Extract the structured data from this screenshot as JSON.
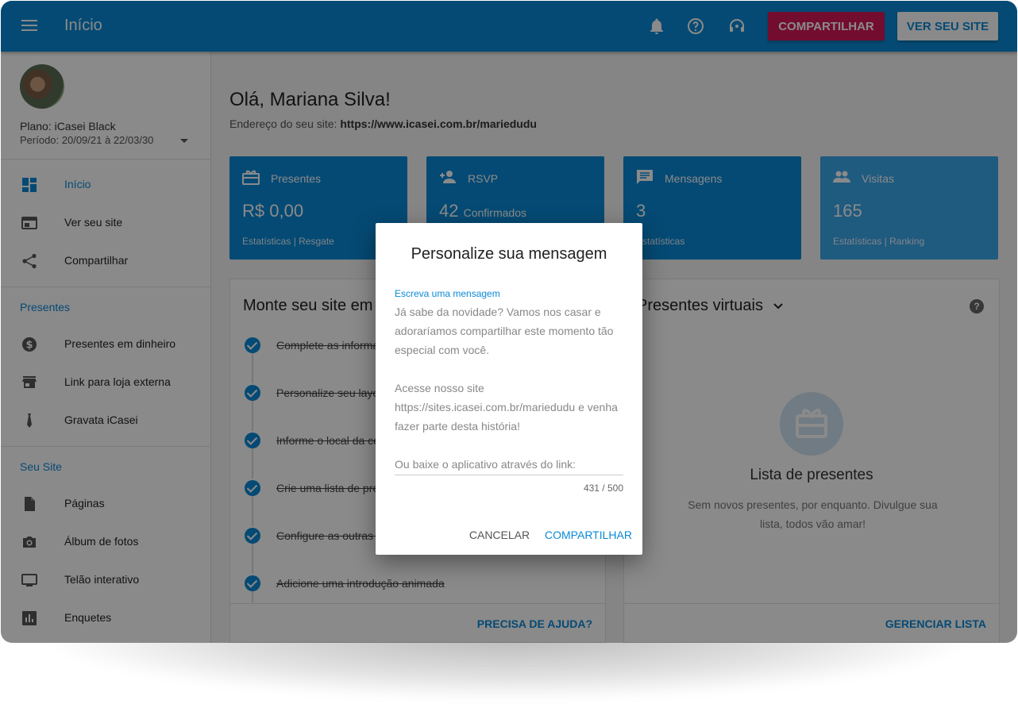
{
  "topbar": {
    "title": "Início",
    "share_label": "COMPARTILHAR",
    "site_label": "VER SEU SITE",
    "icons": [
      "menu-icon",
      "bell-icon",
      "help-circle-icon",
      "support-icon"
    ]
  },
  "sidebar": {
    "plan": "Plano: iCasei Black",
    "period": "Período: 20/09/21 à 22/03/30",
    "items": [
      {
        "label": "Início",
        "icon": "dashboard-icon"
      },
      {
        "label": "Ver seu site",
        "icon": "browser-icon"
      },
      {
        "label": "Compartilhar",
        "icon": "share-icon"
      }
    ],
    "section_gifts": "Presentes",
    "gift_items": [
      {
        "label": "Presentes em dinheiro",
        "icon": "dollar-icon"
      },
      {
        "label": "Link para loja externa",
        "icon": "store-icon"
      },
      {
        "label": "Gravata iCasei",
        "icon": "tie-icon"
      }
    ],
    "section_site": "Seu Site",
    "site_items": [
      {
        "label": "Páginas",
        "icon": "page-icon"
      },
      {
        "label": "Álbum de fotos",
        "icon": "camera-icon"
      },
      {
        "label": "Telão interativo",
        "icon": "monitor-icon"
      },
      {
        "label": "Enquetes",
        "icon": "poll-icon"
      }
    ]
  },
  "main": {
    "greeting": "Olá, Mariana Silva!",
    "address_label": "Endereço do seu site:",
    "address_url": "https://www.icasei.com.br/mariedudu",
    "stats": [
      {
        "label": "Presentes",
        "value": "R$ 0,00",
        "value_suffix": "",
        "links": "Estatísticas  |  Resgate",
        "color": "#0a8ad6",
        "icon": "gift-icon"
      },
      {
        "label": "RSVP",
        "value": "42",
        "value_suffix": "Confirmados",
        "links": "",
        "color": "#0a8ad6",
        "icon": "person-add-icon"
      },
      {
        "label": "Mensagens",
        "value": "3",
        "value_suffix": "",
        "links": "Estatísticas",
        "color": "#0a8ad6",
        "icon": "message-icon"
      },
      {
        "label": "Visitas",
        "value": "165",
        "value_suffix": "",
        "links": "Estatísticas  |  Ranking",
        "color": "#3aa6ea",
        "icon": "people-icon"
      }
    ],
    "setup_card": {
      "title": "Monte seu site em",
      "steps": [
        "Complete as informa",
        "Personalize seu layo",
        "Informe o local da ce",
        "Crie uma lista de pre",
        "Configure as outras p",
        "Adicione uma introdução animada"
      ],
      "footer": "PRECISA DE AJUDA?"
    },
    "gifts_card": {
      "title": "Presentes virtuais",
      "empty_title": "Lista de presentes",
      "empty_text": "Sem novos presentes, por enquanto. Divulgue sua lista, todos vão amar!",
      "footer": "GERENCIAR LISTA"
    }
  },
  "dialog": {
    "title": "Personalize sua mensagem",
    "field_label": "Escreva uma mensagem",
    "message": "Já sabe da novidade? Vamos nos casar e adoraríamos compartilhar este momento tão especial com você.\n\nAcesse nosso site\nhttps://sites.icasei.com.br/mariedudu e venha fazer parte desta história!\n\nOu baixe o aplicativo através do link:",
    "counter": "431 / 500",
    "cancel": "CANCELAR",
    "share": "COMPARTILHAR"
  }
}
